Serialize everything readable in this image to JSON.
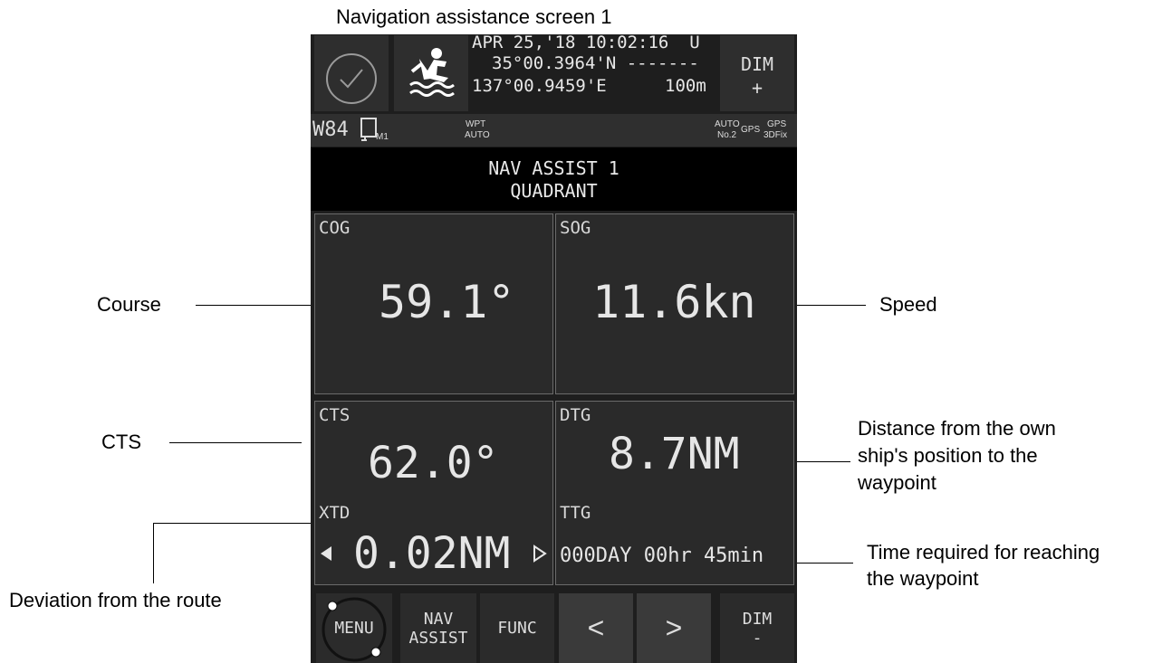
{
  "caption": "Navigation assistance screen 1",
  "annotations": {
    "course": "Course",
    "speed": "Speed",
    "cts": "CTS",
    "dtg_line1": "Distance from the own",
    "dtg_line2": "ship's position to the",
    "dtg_line3": "waypoint",
    "xtd": "Deviation from the route",
    "ttg_line1": "Time required for reaching",
    "ttg_line2": "the waypoint"
  },
  "header": {
    "datetime": "APR 25,'18 10:02:16  U",
    "lat": "35°00.3964'N -------",
    "lon": "137°00.9459'E",
    "alt": "100m",
    "dim_up_label": "DIM",
    "dim_up_sign": "+"
  },
  "status": {
    "datum": "W84",
    "mode_sub": "M1",
    "wpt_label": "WPT",
    "wpt_mode": "AUTO",
    "auto": "AUTO",
    "no": "No.2",
    "gps": "GPS",
    "gps2": "GPS",
    "fix": "3DFix"
  },
  "title": {
    "line1": "NAV ASSIST 1",
    "line2": "QUADRANT"
  },
  "cells": {
    "cog_label": "COG",
    "cog_value": "59.1°",
    "sog_label": "SOG",
    "sog_value": "11.6kn",
    "cts_label": "CTS",
    "cts_value": "62.0°",
    "xtd_label": "XTD",
    "xtd_value": "0.02NM",
    "dtg_label": "DTG",
    "dtg_value": "8.7NM",
    "ttg_label": "TTG",
    "ttg_value": "000DAY 00hr 45min"
  },
  "softkeys": {
    "menu": "MENU",
    "nav1": "NAV",
    "nav2": "ASSIST",
    "func": "FUNC",
    "prev": "<",
    "next": ">",
    "dim_down_label": "DIM",
    "dim_down_sign": "-"
  }
}
